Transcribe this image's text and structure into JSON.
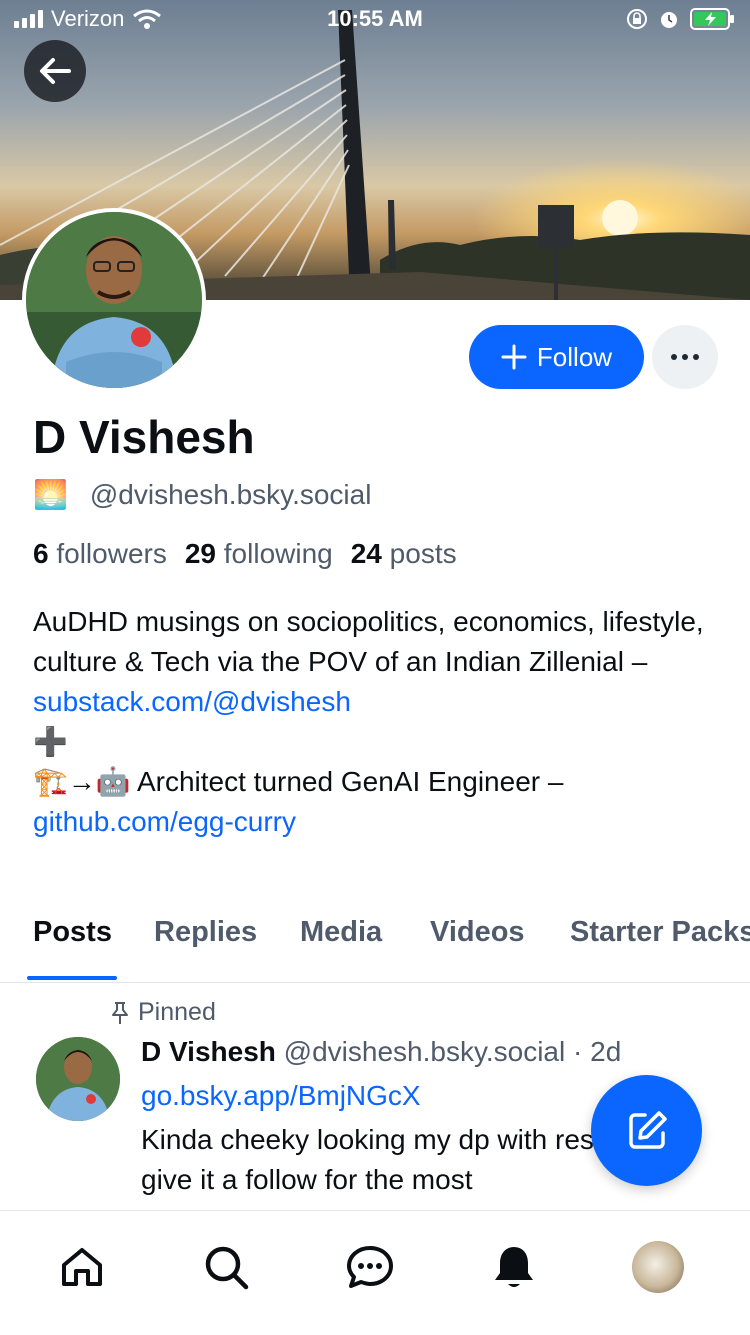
{
  "status_bar": {
    "carrier": "Verizon",
    "time": "10:55 AM"
  },
  "profile": {
    "display_name": "D Vishesh",
    "handle_emoji": "🌅",
    "handle": "@dvishesh.bsky.social",
    "followers_count": "6",
    "followers_label": "followers",
    "following_count": "29",
    "following_label": "following",
    "posts_count": "24",
    "posts_label": "posts",
    "bio_line1": "AuDHD musings on sociopolitics, economics, lifestyle, culture & Tech via the POV of an Indian Zillenial –",
    "bio_link1": "substack.com/@dvishesh",
    "bio_plus": "➕",
    "bio_line2_prefix": "🏗️→🤖",
    "bio_line2": " Architect turned GenAI Engineer –",
    "bio_link2": "github.com/egg-curry"
  },
  "actions": {
    "follow_label": "Follow"
  },
  "tabs": [
    {
      "label": "Posts",
      "active": true
    },
    {
      "label": "Replies"
    },
    {
      "label": "Media"
    },
    {
      "label": "Videos"
    },
    {
      "label": "Starter Packs"
    }
  ],
  "post": {
    "pinned_label": "Pinned",
    "author": "D Vishesh",
    "handle": "@dvishesh.bsky.social",
    "time": "· 2d",
    "link": "go.bsky.app/BmjNGcX",
    "text": "Kinda cheeky looking my dp with rest of'em, give it a follow for the most"
  },
  "colors": {
    "accent": "#0a66ff",
    "muted_text": "#4f5b6b"
  },
  "icons": {
    "nav": [
      "home-icon",
      "search-icon",
      "chat-icon",
      "bell-icon",
      "profile-avatar"
    ]
  }
}
